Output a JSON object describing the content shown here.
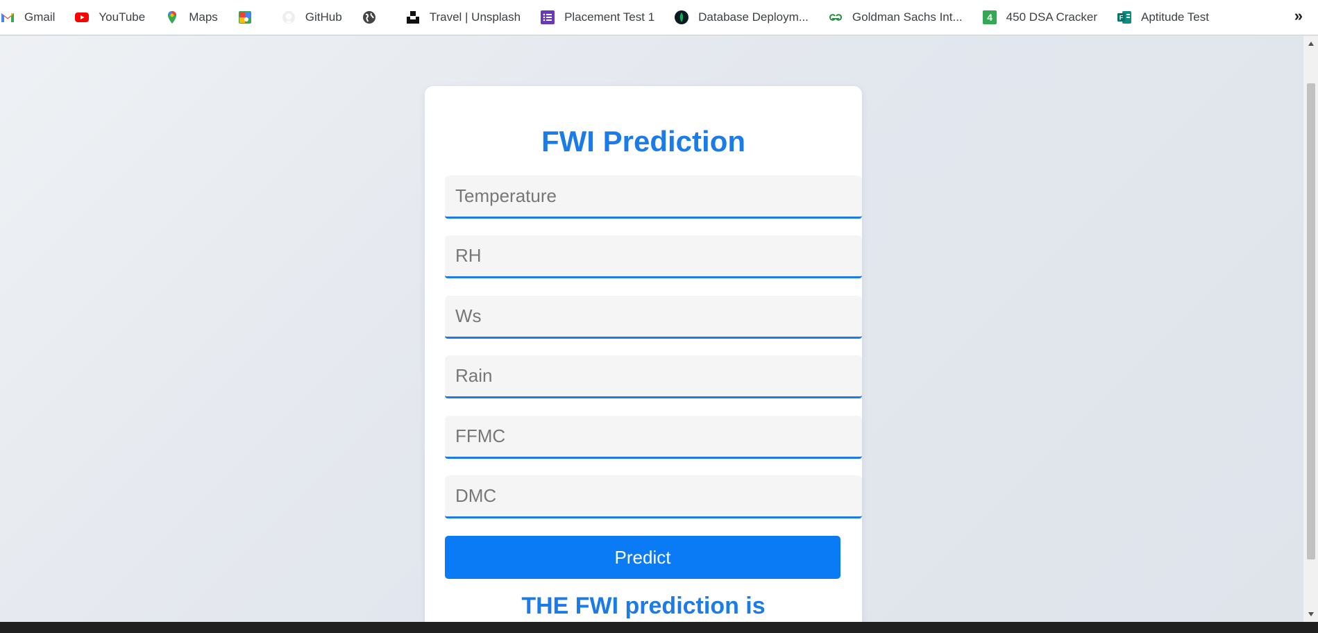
{
  "bookmarks_bar": {
    "items": [
      {
        "label": "Gmail",
        "icon": "gmail-icon"
      },
      {
        "label": "YouTube",
        "icon": "youtube-icon"
      },
      {
        "label": "Maps",
        "icon": "maps-icon"
      },
      {
        "label": "",
        "icon": "google-apps-icon"
      },
      {
        "label": "GitHub",
        "icon": "github-icon"
      },
      {
        "label": "",
        "icon": "globe-icon"
      },
      {
        "label": "Travel | Unsplash",
        "icon": "unsplash-icon"
      },
      {
        "label": "Placement Test 1",
        "icon": "forms-icon"
      },
      {
        "label": "Database Deploym...",
        "icon": "mongodb-leaf-icon"
      },
      {
        "label": "Goldman Sachs Int...",
        "icon": "geeksforgeeks-icon"
      },
      {
        "label": "450 DSA Cracker",
        "icon": "number-four-icon"
      },
      {
        "label": "Aptitude Test",
        "icon": "ms-forms-icon"
      }
    ],
    "overflow_label": "»"
  },
  "form": {
    "title": "FWI Prediction",
    "fields": [
      {
        "placeholder": "Temperature",
        "value": ""
      },
      {
        "placeholder": "RH",
        "value": ""
      },
      {
        "placeholder": "Ws",
        "value": ""
      },
      {
        "placeholder": "Rain",
        "value": ""
      },
      {
        "placeholder": "FFMC",
        "value": ""
      },
      {
        "placeholder": "DMC",
        "value": ""
      }
    ],
    "submit_label": "Predict",
    "result_text": "THE FWI prediction is"
  },
  "colors": {
    "accent": "#1a7be9",
    "button": "#0a7af5",
    "field_bg": "#f5f5f5"
  }
}
